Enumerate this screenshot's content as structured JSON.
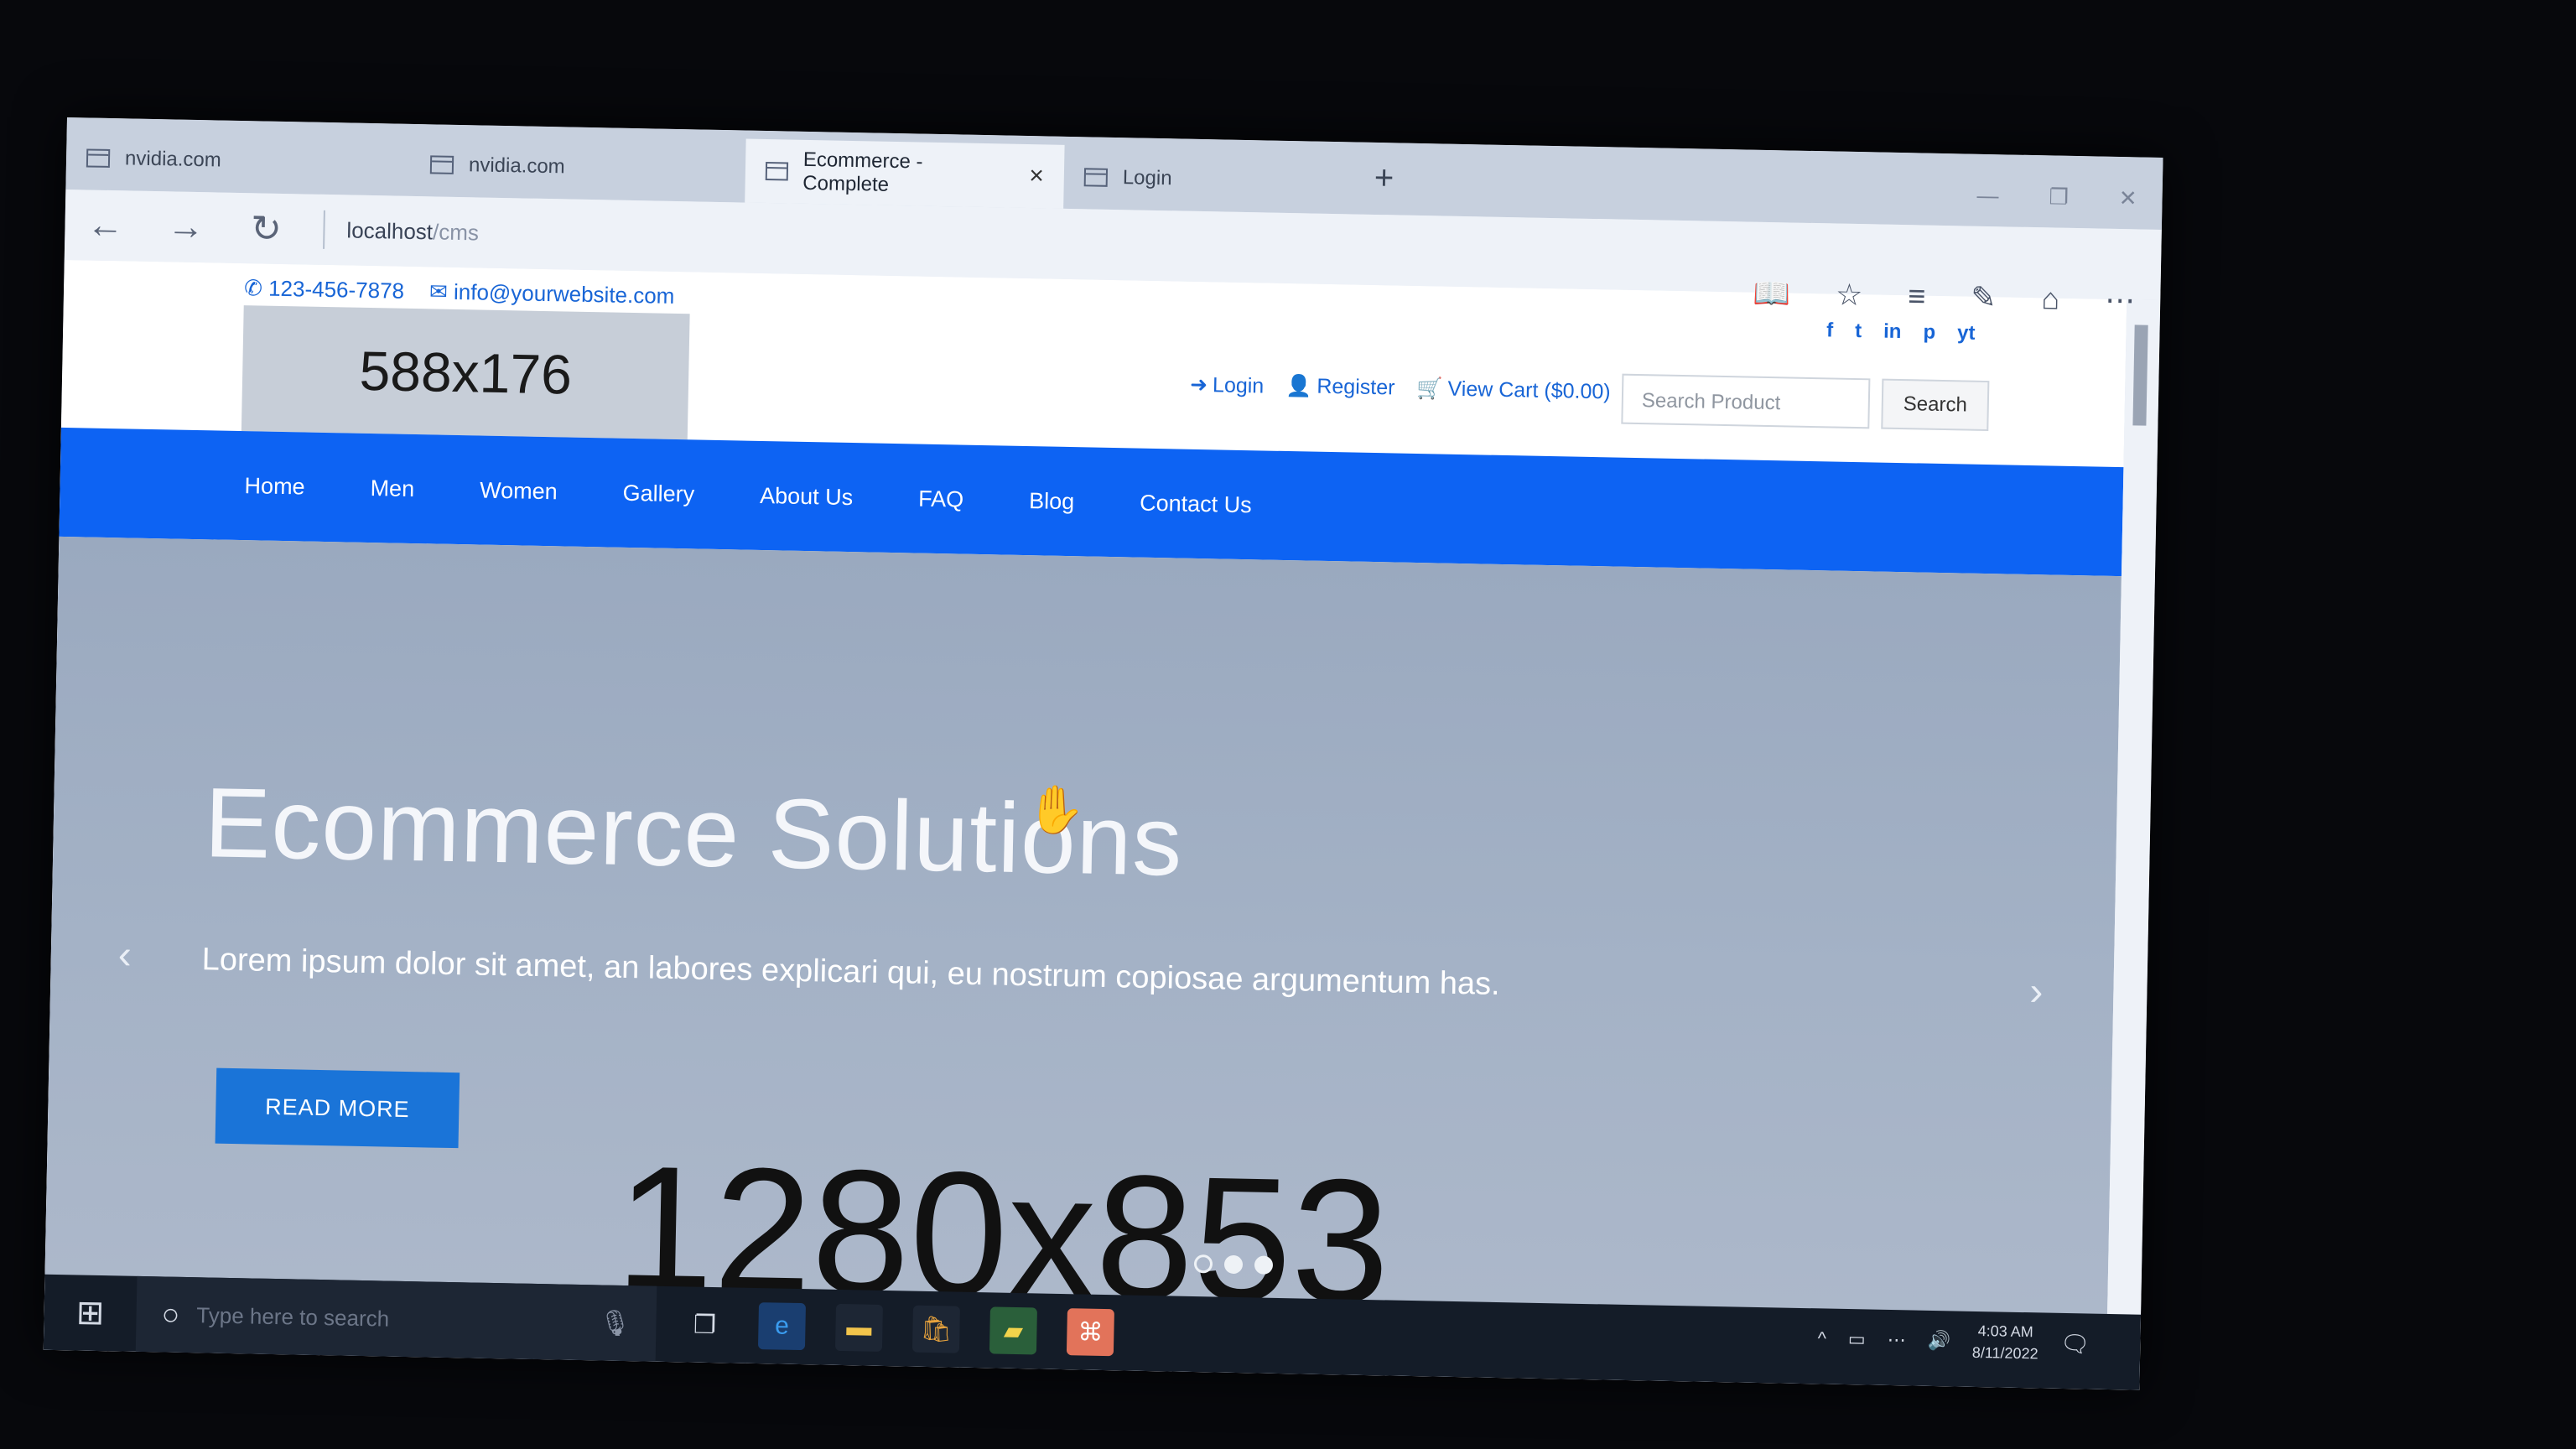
{
  "tabs": [
    {
      "label": "nvidia.com"
    },
    {
      "label": "nvidia.com"
    },
    {
      "label": "Ecommerce - Complete"
    },
    {
      "label": "Login"
    }
  ],
  "address": {
    "host": "localhost",
    "path": "/cms"
  },
  "site": {
    "phone": "123-456-7878",
    "email": "info@yourwebsite.com",
    "logo_text": "588x176",
    "social": [
      "f",
      "t",
      "in",
      "p",
      "yt"
    ],
    "account": {
      "login": "Login",
      "register": "Register",
      "cart": "View Cart ($0.00)"
    },
    "search": {
      "placeholder": "Search Product",
      "button": "Search"
    },
    "nav": [
      "Home",
      "Men",
      "Women",
      "Gallery",
      "About Us",
      "FAQ",
      "Blog",
      "Contact Us"
    ],
    "hero": {
      "title": "Ecommerce Solutions",
      "subtitle": "Lorem ipsum dolor sit amet, an labores explicari qui, eu nostrum copiosae argumentum has.",
      "button": "READ MORE",
      "image_text": "1280x853"
    }
  },
  "taskbar": {
    "search_placeholder": "Type here to search",
    "time": "4:03 AM",
    "date": "8/11/2022"
  },
  "icons": {
    "browser": "edge-icon",
    "explorer": "folder-icon",
    "store": "store-icon"
  },
  "colors": {
    "nav": "#0d63f3",
    "accent": "#1a74d8",
    "link": "#1865d6"
  }
}
